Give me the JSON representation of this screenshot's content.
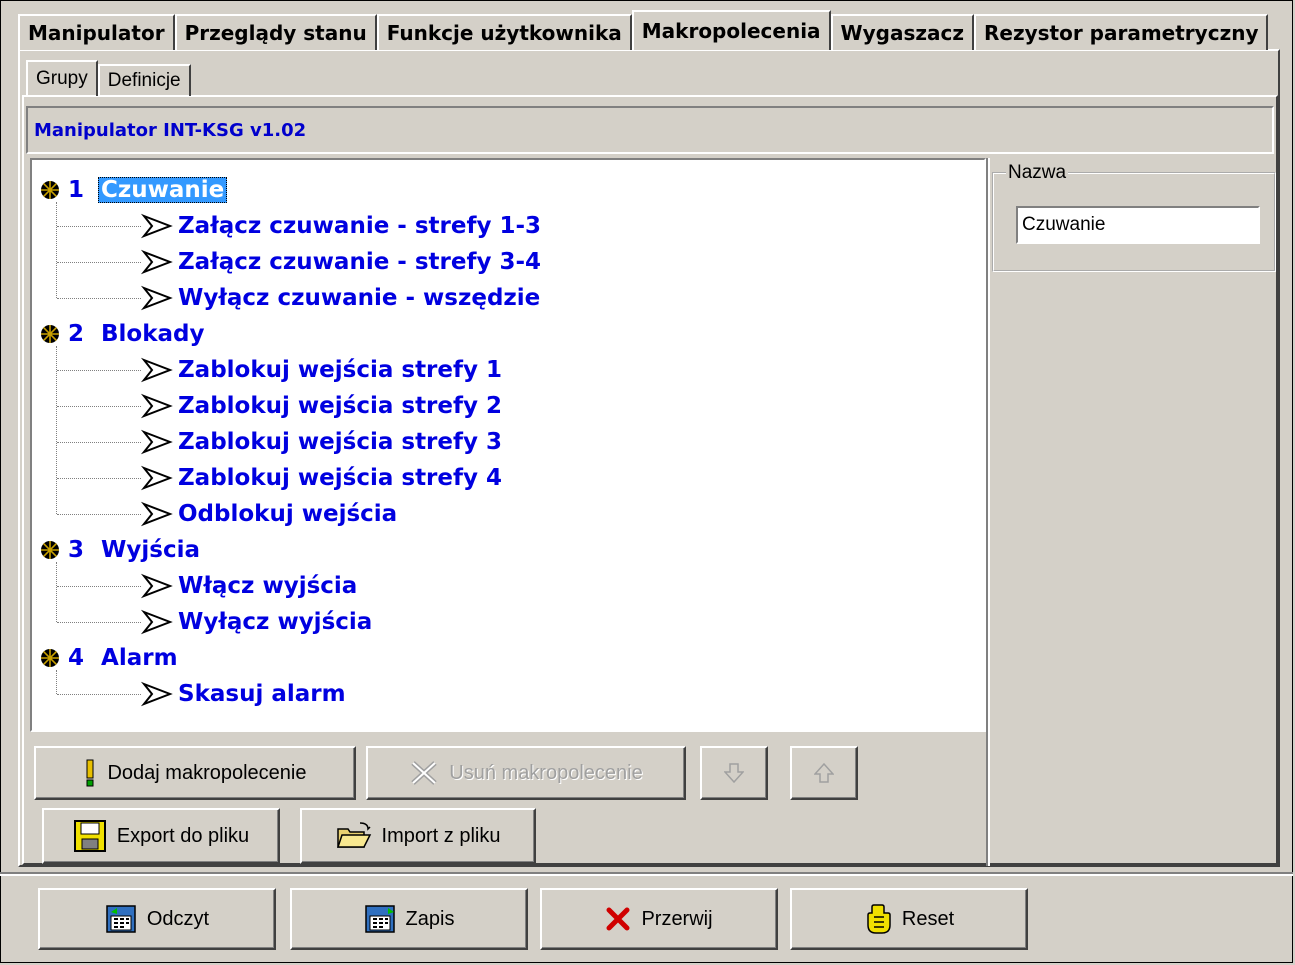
{
  "top_tabs": [
    "Manipulator",
    "Przeglądy stanu",
    "Funkcje użytkownika",
    "Makropolecenia",
    "Wygaszacz",
    "Rezystor parametryczny"
  ],
  "sub_tabs": [
    "Grupy",
    "Definicje"
  ],
  "header_title": "Manipulator INT-KSG v1.02",
  "tree": {
    "groups": [
      {
        "number": "1",
        "label": "Czuwanie",
        "items": [
          "Załącz czuwanie - strefy 1-3",
          "Załącz czuwanie - strefy 3-4",
          "Wyłącz czuwanie - wszędzie"
        ]
      },
      {
        "number": "2",
        "label": "Blokady",
        "items": [
          "Zablokuj wejścia strefy 1",
          "Zablokuj wejścia strefy 2",
          "Zablokuj wejścia strefy 3",
          "Zablokuj wejścia strefy 4",
          "Odblokuj wejścia"
        ]
      },
      {
        "number": "3",
        "label": "Wyjścia",
        "items": [
          "Włącz wyjścia",
          "Wyłącz wyjścia"
        ]
      },
      {
        "number": "4",
        "label": "Alarm",
        "items": [
          "Skasuj alarm"
        ]
      }
    ]
  },
  "name_panel": {
    "legend": "Nazwa",
    "value": "Czuwanie"
  },
  "buttons": {
    "add": "Dodaj makropolecenie",
    "remove": "Usuń makropolecenie",
    "export": "Export do pliku",
    "import": "Import z pliku",
    "read": "Odczyt",
    "write": "Zapis",
    "abort": "Przerwij",
    "reset": "Reset"
  },
  "colors": {
    "tree_text": "#0000e0",
    "selection": "#3399ff",
    "header_text": "#0000cc"
  }
}
